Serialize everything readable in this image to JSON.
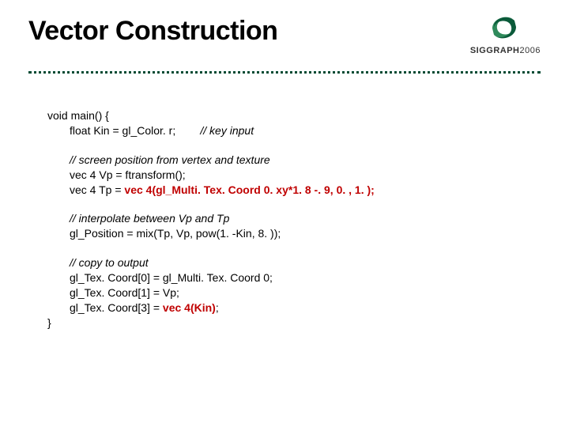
{
  "title": "Vector Construction",
  "logo": {
    "brand": "SIGGRAPH",
    "year": "2006"
  },
  "code": {
    "l1": "void main() {",
    "l2a": "float Kin = gl_Color. r;",
    "l2b": "// key input",
    "l3": "// screen position from vertex and texture",
    "l4": "vec 4 Vp = ftransform();",
    "l5a": "vec 4 Tp = ",
    "l5b": "vec 4(gl_Multi. Tex. Coord 0. xy*1. 8 -. 9, 0. , 1. );",
    "l6": "// interpolate between Vp and Tp",
    "l7": "gl_Position = mix(Tp, Vp, pow(1. -Kin, 8. ));",
    "l8": "// copy to output",
    "l9": "gl_Tex. Coord[0] = gl_Multi. Tex. Coord 0;",
    "l10": "gl_Tex. Coord[1] = Vp;",
    "l11a": "gl_Tex. Coord[3] = ",
    "l11b": "vec 4(Kin)",
    "l11c": ";",
    "l12": "}"
  }
}
